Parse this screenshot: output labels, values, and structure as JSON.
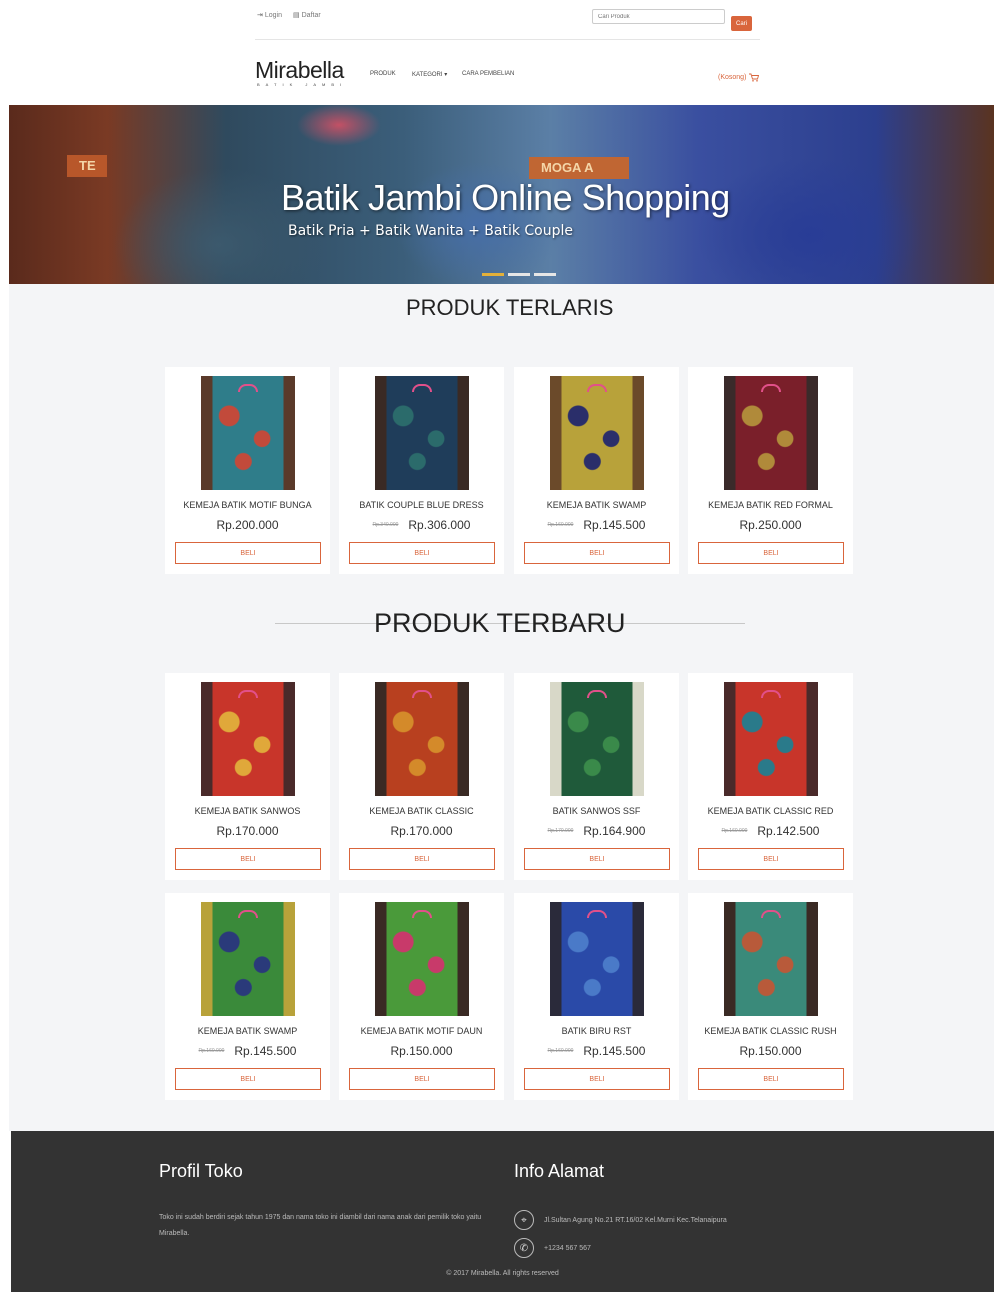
{
  "topbar": {
    "login_label": "Login",
    "register_label": "Daftar",
    "search_placeholder": "Cari Produk",
    "search_button": "Cari"
  },
  "nav": {
    "logo_main": "Mirabella",
    "logo_sub": "BATIK JAMBI",
    "items": [
      {
        "label": "PRODUK"
      },
      {
        "label": "KATEGORI ▾"
      },
      {
        "label": "CARA PEMBELIAN"
      }
    ],
    "cart_label": "(Kosong)"
  },
  "hero": {
    "title": "Batik Jambi Online Shopping",
    "subtitle": "Batik Pria + Batik Wanita + Batik Couple",
    "sign_left": "TE",
    "sign_right": "MOGA A",
    "slide_count": 3,
    "active_slide": 1
  },
  "bestsellers": {
    "title": "PRODUK TERLARIS",
    "products": [
      {
        "name": "KEMEJA BATIK MOTIF BUNGA",
        "old_price": "",
        "price": "Rp.200.000",
        "buy": "BELI",
        "colors": [
          "#2f7d8a",
          "#c24a3b",
          "#5a3a2a"
        ]
      },
      {
        "name": "BATIK COUPLE BLUE DRESS",
        "old_price": "Rp.340.000",
        "price": "Rp.306.000",
        "buy": "BELI",
        "colors": [
          "#1f3d5a",
          "#2b6b6b",
          "#3a2a24"
        ]
      },
      {
        "name": "KEMEJA BATIK SWAMP",
        "old_price": "Rp.160.000",
        "price": "Rp.145.500",
        "buy": "BELI",
        "colors": [
          "#b8a23a",
          "#2a2e6a",
          "#6b4a2a"
        ]
      },
      {
        "name": "KEMEJA BATIK RED FORMAL",
        "old_price": "",
        "price": "Rp.250.000",
        "buy": "BELI",
        "colors": [
          "#7a1f2a",
          "#b08a3a",
          "#3a2a2a"
        ]
      }
    ]
  },
  "newest": {
    "title": "PRODUK TERBARU",
    "products": [
      {
        "name": "KEMEJA BATIK SANWOS",
        "old_price": "",
        "price": "Rp.170.000",
        "buy": "BELI",
        "colors": [
          "#c8352a",
          "#e0a83a",
          "#4a2a2a"
        ]
      },
      {
        "name": "KEMEJA BATIK CLASSIC",
        "old_price": "",
        "price": "Rp.170.000",
        "buy": "BELI",
        "colors": [
          "#b8401f",
          "#d48a2a",
          "#3a2a24"
        ]
      },
      {
        "name": "BATIK SANWOS SSF",
        "old_price": "Rp.170.000",
        "price": "Rp.164.900",
        "buy": "BELI",
        "colors": [
          "#1f5a3a",
          "#3a8a4a",
          "#d8d8c8"
        ]
      },
      {
        "name": "KEMEJA BATIK CLASSIC RED",
        "old_price": "Rp.160.000",
        "price": "Rp.142.500",
        "buy": "BELI",
        "colors": [
          "#c8352a",
          "#2a7a8a",
          "#4a2a2a"
        ]
      },
      {
        "name": "KEMEJA BATIK SWAMP",
        "old_price": "Rp.160.000",
        "price": "Rp.145.500",
        "buy": "BELI",
        "colors": [
          "#3a8a3a",
          "#2a3a7a",
          "#b8a23a"
        ]
      },
      {
        "name": "KEMEJA BATIK MOTIF DAUN",
        "old_price": "",
        "price": "Rp.150.000",
        "buy": "BELI",
        "colors": [
          "#4a9a3a",
          "#c83a6a",
          "#3a2a24"
        ]
      },
      {
        "name": "BATIK BIRU RST",
        "old_price": "Rp.160.000",
        "price": "Rp.145.500",
        "buy": "BELI",
        "colors": [
          "#2a4aa8",
          "#4a7ac8",
          "#2a2a3a"
        ]
      },
      {
        "name": "KEMEJA BATIK CLASSIC RUSH",
        "old_price": "",
        "price": "Rp.150.000",
        "buy": "BELI",
        "colors": [
          "#3a8a7a",
          "#b85a3a",
          "#3a2a24"
        ]
      }
    ]
  },
  "footer": {
    "profile_title": "Profil Toko",
    "profile_text": "Toko ini sudah berdiri sejak tahun 1975 dan nama toko ini diambil dari nama anak dari pemilik toko yaitu Mirabella.",
    "address_title": "Info Alamat",
    "address": "Jl.Sultan Agung No.21 RT.16/02 Kel.Murni Kec.Telanaipura",
    "phone": "+1234 567 567",
    "copyright": "© 2017 Mirabella. All rights reserved"
  }
}
